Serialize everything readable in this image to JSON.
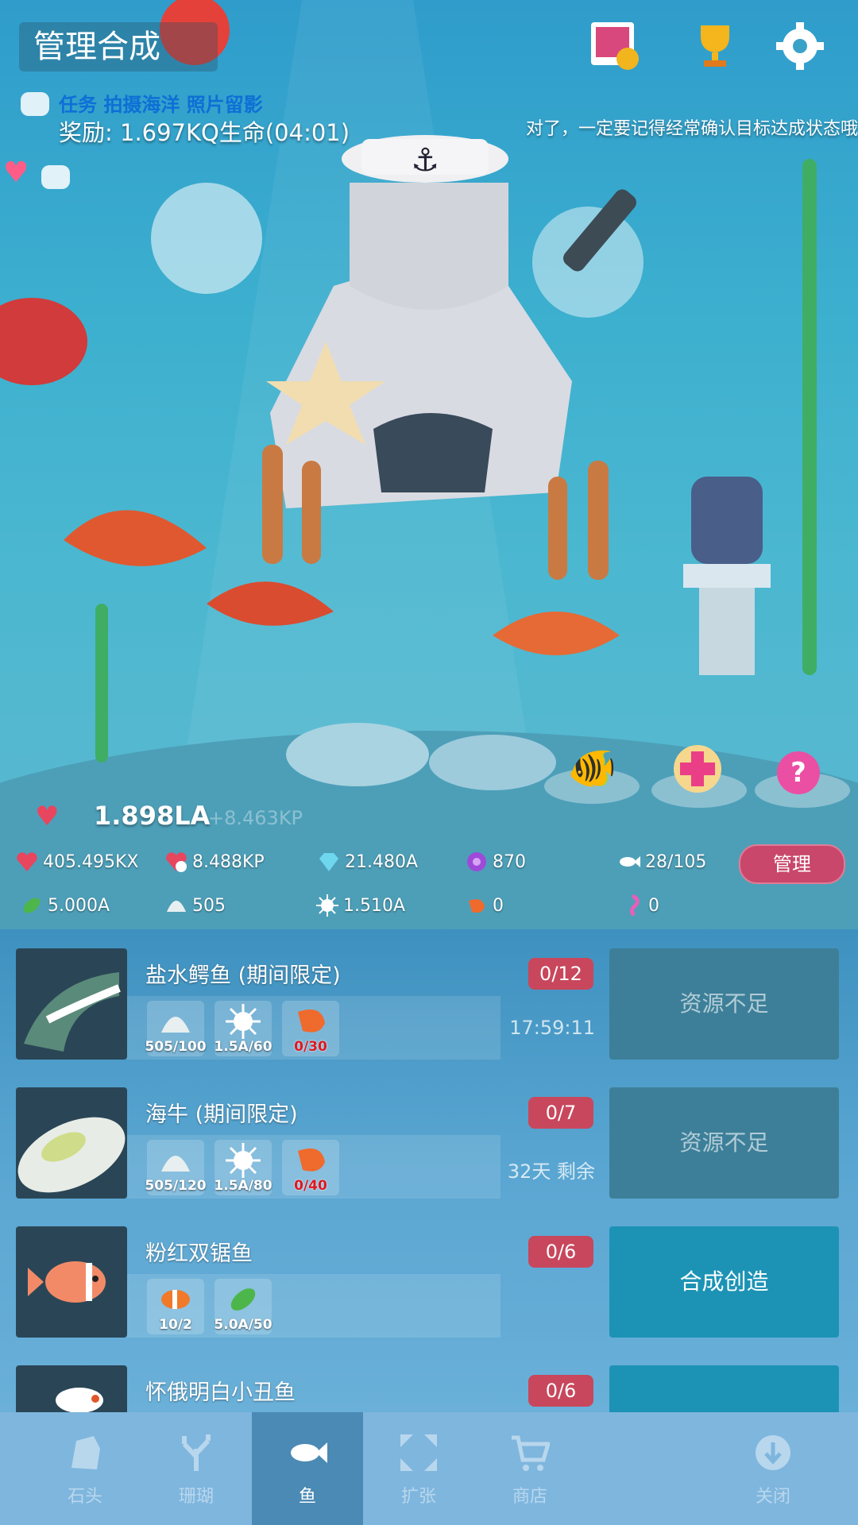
{
  "header": {
    "title": "管理合成"
  },
  "mission": {
    "text": "任务 拍摄海洋 照片留影",
    "reward": "奖励: 1.697KQ生命(04:01)"
  },
  "tip": "对了，一定要记得经常确认目标达成状态哦",
  "life": {
    "main": "1.898LA",
    "rate": "+8.463KP"
  },
  "stats_row1": [
    {
      "icon": "heart-tap-icon",
      "value": "405.495KX"
    },
    {
      "icon": "heart-clock-icon",
      "value": "8.488KP"
    },
    {
      "icon": "diamond-icon",
      "value": "21.480A"
    },
    {
      "icon": "pearl-icon",
      "value": "870"
    },
    {
      "icon": "fish-icon",
      "value": "28/105"
    }
  ],
  "manage_label": "管理",
  "stats_row2": [
    {
      "icon": "leaf-icon",
      "value": "5.000A"
    },
    {
      "icon": "shell-icon",
      "value": "505"
    },
    {
      "icon": "urchin-icon",
      "value": "1.510A"
    },
    {
      "icon": "shrimp-icon",
      "value": "0"
    },
    {
      "icon": "seahorse-icon",
      "value": "0"
    }
  ],
  "fish_list": [
    {
      "name": "盐水鳄鱼 (期间限定)",
      "count": "0/12",
      "reqs": [
        "505/100",
        "1.5A/60",
        "0/30"
      ],
      "timer": "17:59:11",
      "action": "资源不足",
      "enabled": false,
      "color": "#5a8a7a"
    },
    {
      "name": "海牛 (期间限定)",
      "count": "0/7",
      "reqs": [
        "505/120",
        "1.5A/80",
        "0/40"
      ],
      "timer": "32天 剩余",
      "action": "资源不足",
      "enabled": false,
      "color": "#e8ece6"
    },
    {
      "name": "粉红双锯鱼",
      "count": "0/6",
      "reqs": [
        "10/2",
        "5.0A/50"
      ],
      "timer": "",
      "action": "合成创造",
      "enabled": true,
      "color": "#f28a68"
    },
    {
      "name": "怀俄明白小丑鱼",
      "count": "0/6",
      "reqs": [],
      "timer": "",
      "action": "",
      "enabled": true,
      "color": "#ffffff"
    }
  ],
  "nav": [
    {
      "label": "石头",
      "icon": "rock-icon"
    },
    {
      "label": "珊瑚",
      "icon": "coral-icon"
    },
    {
      "label": "鱼",
      "icon": "fish-icon"
    },
    {
      "label": "扩张",
      "icon": "expand-icon"
    },
    {
      "label": "商店",
      "icon": "cart-icon"
    },
    {
      "label": "关闭",
      "icon": "close-down-icon"
    }
  ],
  "active_tab": "鱼"
}
